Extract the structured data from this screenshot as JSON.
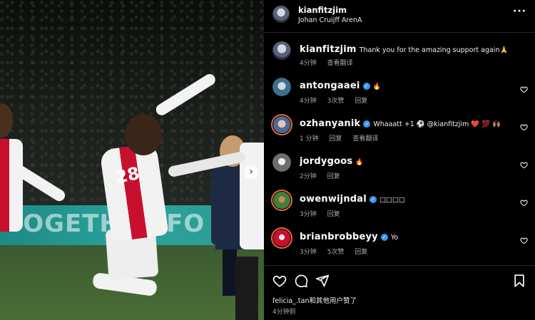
{
  "photo": {
    "board_text": "TOGETHER FO",
    "jersey_number": "28"
  },
  "header": {
    "username": "kianfitzjim",
    "location": "Johan Cruijff ArenA",
    "more_icon": "more-horizontal-icon"
  },
  "caption": {
    "username": "kianfitzjim",
    "text": "Thank you for the amazing support again🙏",
    "time": "4分钟",
    "translate": "查看翻译"
  },
  "comments": [
    {
      "username": "antongaaei",
      "verified": true,
      "text": "🔥",
      "time": "4分钟",
      "likes": "3次赞",
      "reply": "回复",
      "translate": ""
    },
    {
      "username": "ozhanyanik",
      "verified": true,
      "text": "Whaaatt +1 ⚽ @kianfitzjim ❤️ 💯 🙌🏽",
      "time": "1 分钟",
      "likes": "",
      "reply": "回复",
      "translate": "查看翻译"
    },
    {
      "username": "jordygoos",
      "verified": false,
      "text": "🔥",
      "time": "2分钟",
      "likes": "",
      "reply": "回复",
      "translate": ""
    },
    {
      "username": "owenwijndal",
      "verified": true,
      "text": "□□□□",
      "time": "3分钟",
      "likes": "",
      "reply": "回复",
      "translate": ""
    },
    {
      "username": "brianbrobbeyy",
      "verified": true,
      "text": "Yo",
      "time": "3分钟",
      "likes": "5次赞",
      "reply": "回复",
      "translate": ""
    }
  ],
  "footer": {
    "liked_by_user": "felicia_.tan",
    "liked_by_rest": "和其他用户赞了",
    "time": "4分钟前"
  },
  "colors": {
    "verified": "#3897f0",
    "background": "#000000",
    "muted_text": "#a8a8a8"
  }
}
